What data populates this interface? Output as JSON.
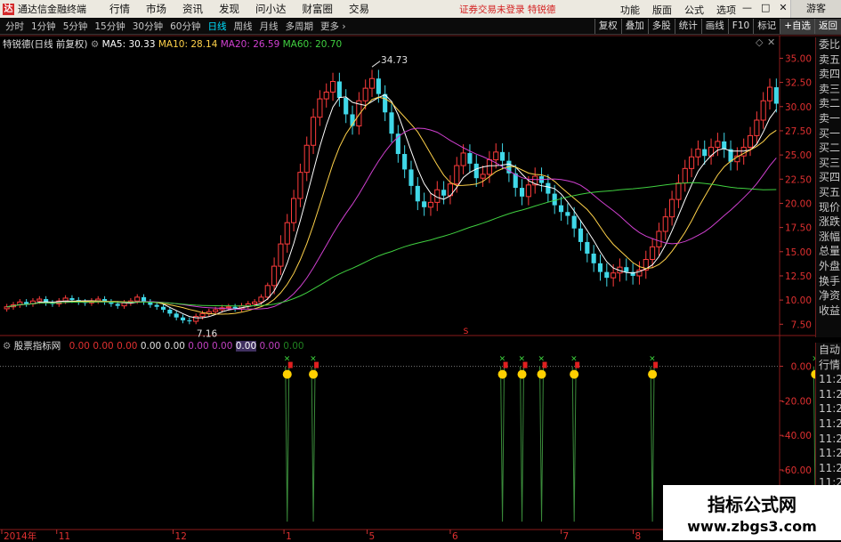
{
  "menubar": {
    "app_title": "通达信金融终端",
    "menus": [
      "行情",
      "市场",
      "资讯",
      "发现",
      "问小达",
      "财富圈",
      "交易"
    ],
    "warning": "证券交易未登录",
    "stock_name": "特锐德",
    "right_menus": [
      "功能",
      "版面",
      "公式",
      "选项"
    ],
    "guest": "游客"
  },
  "toolbar": {
    "periods": [
      "分时",
      "1分钟",
      "5分钟",
      "15分钟",
      "30分钟",
      "60分钟",
      "日线",
      "周线",
      "月线",
      "多周期",
      "更多"
    ],
    "active_period": "日线",
    "tools": [
      "复权",
      "叠加",
      "多股",
      "统计",
      "画线",
      "F10",
      "标记",
      "+自选",
      "返回"
    ]
  },
  "main_info": {
    "name": "特锐德(日线 前复权)",
    "ma5": "MA5: 30.33",
    "ma10": "MA10: 28.14",
    "ma20": "MA20: 26.59",
    "ma60": "MA60: 20.70",
    "high_label": "34.73",
    "low_label": "7.16",
    "s_marker": "S"
  },
  "sub_info": {
    "name": "股票指标网",
    "values": [
      "0.00",
      "0.00",
      "0.00",
      "0.00",
      "0.00",
      "0.00",
      "0.00",
      "0.00",
      "0.00",
      "0.00"
    ]
  },
  "price_axis": [
    "35.00",
    "32.50",
    "30.00",
    "27.50",
    "25.00",
    "22.50",
    "20.00",
    "17.50",
    "15.00",
    "12.50",
    "10.00",
    "7.50"
  ],
  "sub_axis": [
    "0.00",
    "-20.00",
    "-40.00",
    "-60.00",
    "-80.00"
  ],
  "date_axis": [
    "2014年",
    "11",
    "12",
    "1",
    "5",
    "6",
    "7",
    "8",
    "9"
  ],
  "right_panel_top": [
    "委比",
    "卖五",
    "卖四",
    "卖三",
    "卖二",
    "卖一",
    "买一",
    "买二",
    "买三",
    "买四",
    "买五",
    "现价",
    "涨跌",
    "涨幅",
    "总量",
    "外盘",
    "换手",
    "净资",
    "收益"
  ],
  "right_panel_bottom": [
    "自动",
    "行情",
    "11:29",
    "11:29",
    "11:29",
    "11:29",
    "11:29",
    "11:29",
    "11:29",
    "11:29",
    "11:29",
    "11:29"
  ],
  "watermark": {
    "line1": "指标公式网",
    "line2": "www.zbgs3.com"
  },
  "chart_data": {
    "type": "candlestick",
    "ylim": [
      7.16,
      35.5
    ],
    "close": [
      9.3,
      9.5,
      9.8,
      9.6,
      9.9,
      10.1,
      9.7,
      9.6,
      9.9,
      10.2,
      10.0,
      9.8,
      9.7,
      9.9,
      10.1,
      9.8,
      9.6,
      9.4,
      9.7,
      9.9,
      10.3,
      9.8,
      9.5,
      9.3,
      9.0,
      8.6,
      8.2,
      7.9,
      7.8,
      8.3,
      8.6,
      8.8,
      9.0,
      9.2,
      9.3,
      9.1,
      9.4,
      9.6,
      9.8,
      10.3,
      11.5,
      13.5,
      15.8,
      18.0,
      20.5,
      23.2,
      26.0,
      28.9,
      30.8,
      31.5,
      32.6,
      30.9,
      29.2,
      28.0,
      30.6,
      31.9,
      32.9,
      31.3,
      29.4,
      27.2,
      25.1,
      23.5,
      21.8,
      20.2,
      19.6,
      20.1,
      21.4,
      20.8,
      22.0,
      23.9,
      25.2,
      24.1,
      22.6,
      23.0,
      24.5,
      25.3,
      24.4,
      23.1,
      21.6,
      20.7,
      21.9,
      22.8,
      22.1,
      21.0,
      19.8,
      19.1,
      18.7,
      17.4,
      16.0,
      14.8,
      13.8,
      12.9,
      12.3,
      12.8,
      13.4,
      12.9,
      12.5,
      13.1,
      14.2,
      15.5,
      17.1,
      18.6,
      20.4,
      22.1,
      23.6,
      24.8,
      25.6,
      24.9,
      25.8,
      26.4,
      25.6,
      24.3,
      24.9,
      25.8,
      27.0,
      28.6,
      30.6,
      32.0,
      30.3
    ],
    "series": [
      {
        "name": "MA5",
        "values": [
          30.33
        ]
      },
      {
        "name": "MA10",
        "values": [
          28.14
        ]
      },
      {
        "name": "MA20",
        "values": [
          26.59
        ]
      },
      {
        "name": "MA60",
        "values": [
          20.7
        ]
      }
    ],
    "sub_chart": {
      "type": "spike",
      "ylim": [
        -93,
        7
      ],
      "signal_bars": [
        43,
        47,
        76,
        79,
        82,
        87,
        99,
        124
      ],
      "signal_value": -90,
      "baseline": 0
    }
  }
}
